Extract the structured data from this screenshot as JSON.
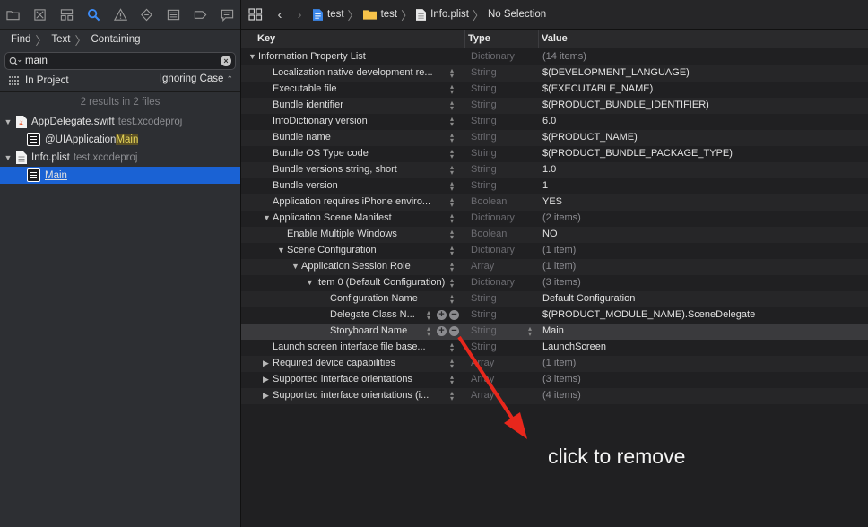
{
  "navigator": {
    "icons": [
      "folder-icon",
      "source-control-icon",
      "symbol-hierarchy-icon",
      "find-icon",
      "issue-warning-icon",
      "test-diamond-icon",
      "debug-icon",
      "breakpoint-icon",
      "report-icon"
    ],
    "find_bar": {
      "mode": "Find",
      "kind": "Text",
      "match": "Containing"
    },
    "search": {
      "value": "main"
    },
    "scope": {
      "label": "In Project",
      "case_option": "Ignoring Case"
    },
    "results_summary": "2 results in 2 files",
    "results": [
      {
        "file": "AppDelegate.swift",
        "project": "test.xcodeproj",
        "match_prefix": "@UIApplication",
        "match_highlight": "Main"
      },
      {
        "file": "Info.plist",
        "project": "test.xcodeproj",
        "match_prefix": "",
        "match_highlight": "Main"
      }
    ]
  },
  "jumpbar": {
    "crumbs": [
      "test",
      "test",
      "Info.plist",
      "No Selection"
    ]
  },
  "plist": {
    "columns": {
      "key": "Key",
      "type": "Type",
      "value": "Value"
    },
    "rows": [
      {
        "key": "Information Property List",
        "type": "Dictionary",
        "value": "(14 items)",
        "depth": 0,
        "disclosure": "open"
      },
      {
        "key": "Localization native development re...",
        "type": "String",
        "value": "$(DEVELOPMENT_LANGUAGE)",
        "depth": 1
      },
      {
        "key": "Executable file",
        "type": "String",
        "value": "$(EXECUTABLE_NAME)",
        "depth": 1
      },
      {
        "key": "Bundle identifier",
        "type": "String",
        "value": "$(PRODUCT_BUNDLE_IDENTIFIER)",
        "depth": 1
      },
      {
        "key": "InfoDictionary version",
        "type": "String",
        "value": "6.0",
        "depth": 1
      },
      {
        "key": "Bundle name",
        "type": "String",
        "value": "$(PRODUCT_NAME)",
        "depth": 1
      },
      {
        "key": "Bundle OS Type code",
        "type": "String",
        "value": "$(PRODUCT_BUNDLE_PACKAGE_TYPE)",
        "depth": 1
      },
      {
        "key": "Bundle versions string, short",
        "type": "String",
        "value": "1.0",
        "depth": 1
      },
      {
        "key": "Bundle version",
        "type": "String",
        "value": "1",
        "depth": 1
      },
      {
        "key": "Application requires iPhone enviro...",
        "type": "Boolean",
        "value": "YES",
        "depth": 1
      },
      {
        "key": "Application Scene Manifest",
        "type": "Dictionary",
        "value": "(2 items)",
        "depth": 1,
        "disclosure": "open"
      },
      {
        "key": "Enable Multiple Windows",
        "type": "Boolean",
        "value": "NO",
        "depth": 2
      },
      {
        "key": "Scene Configuration",
        "type": "Dictionary",
        "value": "(1 item)",
        "depth": 2,
        "disclosure": "open"
      },
      {
        "key": "Application Session Role",
        "type": "Array",
        "value": "(1 item)",
        "depth": 3,
        "disclosure": "open"
      },
      {
        "key": "Item 0 (Default Configuration)",
        "type": "Dictionary",
        "value": "(3 items)",
        "depth": 4,
        "disclosure": "open"
      },
      {
        "key": "Configuration Name",
        "type": "String",
        "value": "Default Configuration",
        "depth": 5
      },
      {
        "key": "Delegate Class N...",
        "type": "String",
        "value": "$(PRODUCT_MODULE_NAME).SceneDelegate",
        "depth": 5,
        "controls": true
      },
      {
        "key": "Storyboard Name",
        "type": "String",
        "value": "Main",
        "depth": 5,
        "controls": true,
        "hover": true
      },
      {
        "key": "Launch screen interface file base...",
        "type": "String",
        "value": "LaunchScreen",
        "depth": 1
      },
      {
        "key": "Required device capabilities",
        "type": "Array",
        "value": "(1 item)",
        "depth": 1,
        "disclosure": "closed"
      },
      {
        "key": "Supported interface orientations",
        "type": "Array",
        "value": "(3 items)",
        "depth": 1,
        "disclosure": "closed"
      },
      {
        "key": "Supported interface orientations (i...",
        "type": "Array",
        "value": "(4 items)",
        "depth": 1,
        "disclosure": "closed"
      }
    ]
  },
  "annotation": {
    "text": "click to remove",
    "arrow_color": "#e8271c"
  }
}
